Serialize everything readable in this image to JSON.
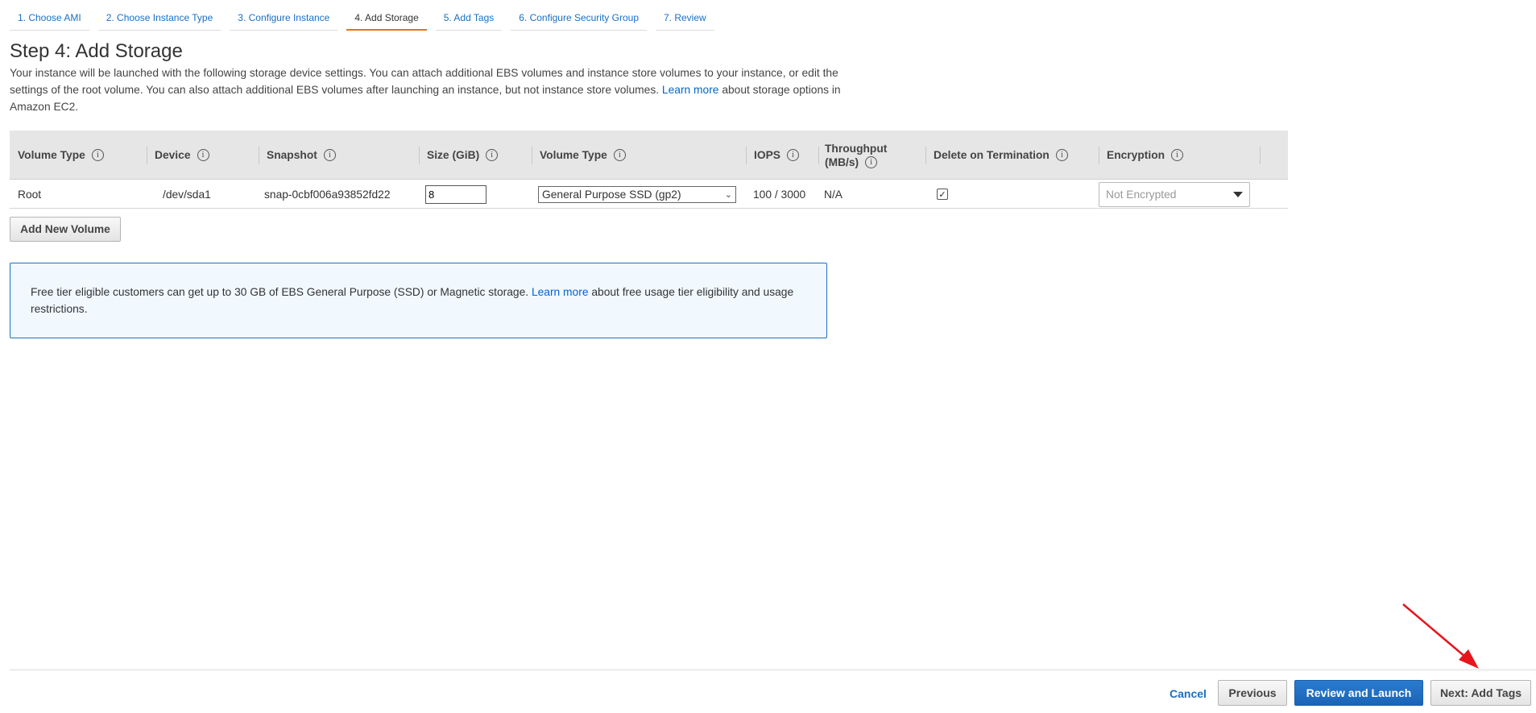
{
  "wizard_tabs": [
    {
      "label": "1. Choose AMI",
      "active": false
    },
    {
      "label": "2. Choose Instance Type",
      "active": false
    },
    {
      "label": "3. Configure Instance",
      "active": false
    },
    {
      "label": "4. Add Storage",
      "active": true
    },
    {
      "label": "5. Add Tags",
      "active": false
    },
    {
      "label": "6. Configure Security Group",
      "active": false
    },
    {
      "label": "7. Review",
      "active": false
    }
  ],
  "page": {
    "title": "Step 4: Add Storage",
    "description_part1": "Your instance will be launched with the following storage device settings. You can attach additional EBS volumes and instance store volumes to your instance, or edit the settings of the root volume. You can also attach additional EBS volumes after launching an instance, but not instance store volumes.",
    "learn_more": "Learn more",
    "description_part2": "about storage options in Amazon EC2."
  },
  "table": {
    "headers": {
      "volume_type": "Volume Type",
      "device": "Device",
      "snapshot": "Snapshot",
      "size": "Size (GiB)",
      "volume_type2": "Volume Type",
      "iops": "IOPS",
      "throughput_line1": "Throughput",
      "throughput_line2": "(MB/s)",
      "delete_on_termination": "Delete on Termination",
      "encryption": "Encryption"
    },
    "info_glyph": "i",
    "row": {
      "volume_type": "Root",
      "device": "/dev/sda1",
      "snapshot": "snap-0cbf006a93852fd22",
      "size": "8",
      "volume_type_select": "General Purpose SSD (gp2)",
      "iops": "100 / 3000",
      "throughput": "N/A",
      "delete_on_termination_checked": true,
      "check_glyph": "✓",
      "encryption": "Not Encrypted"
    }
  },
  "add_volume_button": "Add New Volume",
  "notice": {
    "text_part1": "Free tier eligible customers can get up to 30 GB of EBS General Purpose (SSD) or Magnetic storage.",
    "learn_more": "Learn more",
    "text_part2": "about free usage tier eligibility and usage restrictions."
  },
  "footer": {
    "cancel": "Cancel",
    "previous": "Previous",
    "review_and_launch": "Review and Launch",
    "next": "Next: Add Tags"
  },
  "colors": {
    "accent": "#1e6fc2",
    "active_tab_underline": "#ec7211",
    "annotation_arrow": "#e8141c"
  }
}
